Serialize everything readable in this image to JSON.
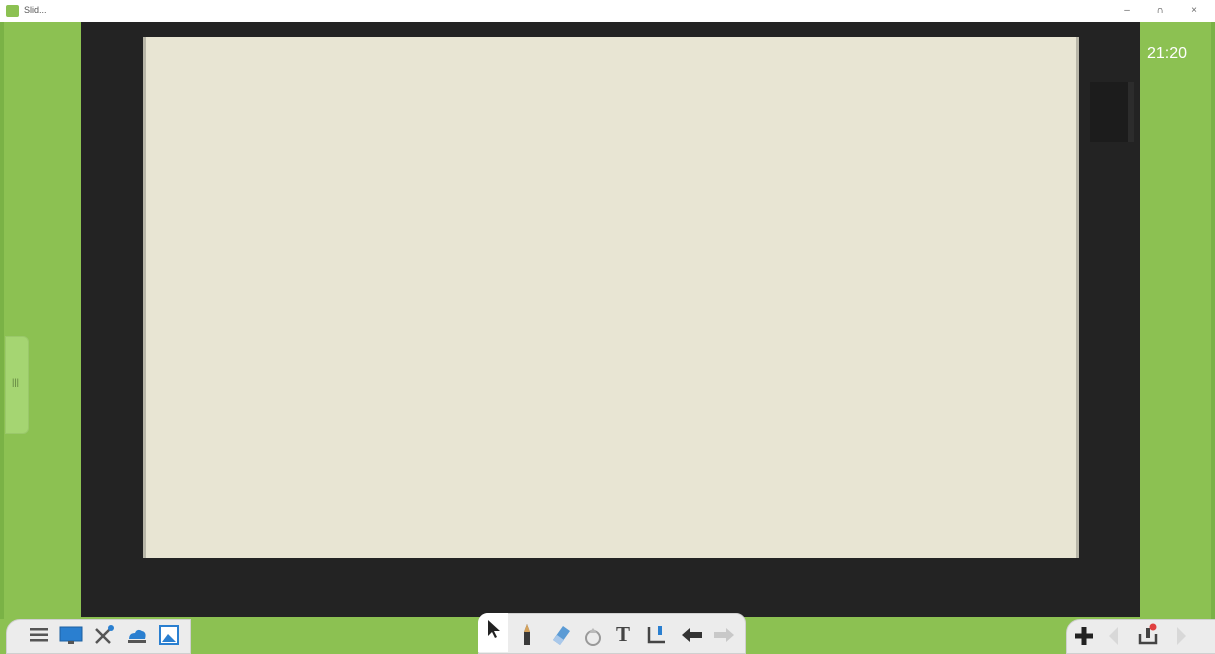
{
  "window": {
    "title": "Slid..."
  },
  "clock": "21:20",
  "side_panel": {
    "tab_label": "|||"
  },
  "left_toolbar": {
    "icons": [
      "menu-icon",
      "screen-icon",
      "tools-icon",
      "cloud-icon",
      "image-icon"
    ]
  },
  "center_toolbar": {
    "icons": [
      "select-arrow-icon",
      "pen-icon",
      "eraser-icon",
      "shape-icon",
      "text-icon",
      "insert-icon",
      "undo-icon",
      "redo-icon"
    ],
    "text_tool_label": "T",
    "active_tool": "select"
  },
  "right_toolbar": {
    "icons": [
      "add-page-icon",
      "prev-page-icon",
      "page-list-icon",
      "next-page-icon"
    ]
  },
  "colors": {
    "background": "#8cc152",
    "board": "#232323",
    "canvas": "#e8e5d3"
  }
}
